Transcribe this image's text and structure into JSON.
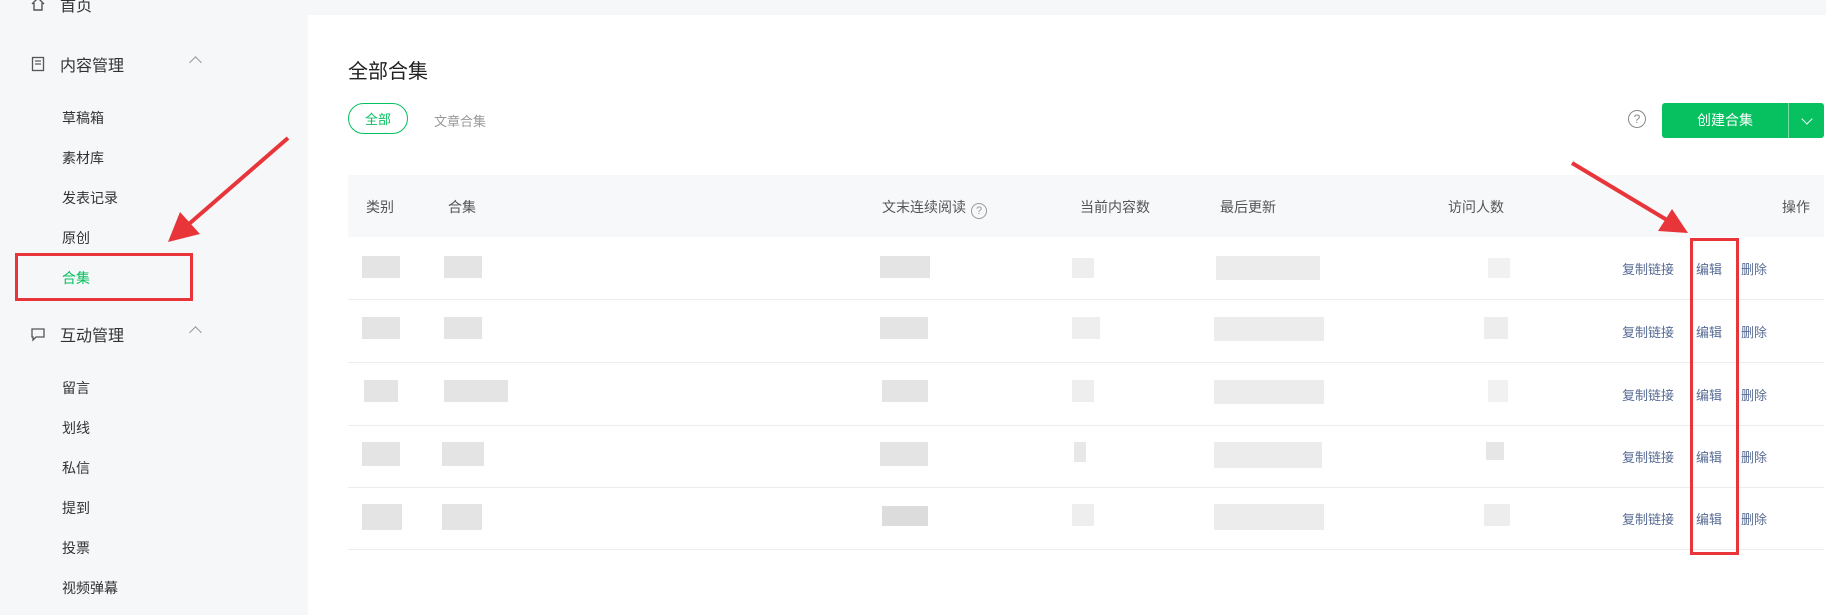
{
  "sidebar": {
    "home_label": "首页",
    "groups": [
      {
        "label": "内容管理",
        "items": [
          "草稿箱",
          "素材库",
          "发表记录",
          "原创",
          "合集"
        ]
      },
      {
        "label": "互动管理",
        "items": [
          "留言",
          "划线",
          "私信",
          "提到",
          "投票",
          "视频弹幕"
        ]
      }
    ],
    "active_item": "合集"
  },
  "main": {
    "title": "全部合集",
    "tabs": [
      "全部",
      "文章合集"
    ],
    "help_icon": "?",
    "create_button_label": "创建合集",
    "table": {
      "headers": [
        "类别",
        "合集",
        "文末连续阅读",
        "当前内容数",
        "最后更新",
        "访问人数",
        "操作"
      ],
      "header_help_icon": "?",
      "row_count": 5,
      "actions": [
        "复制链接",
        "编辑",
        "删除"
      ]
    }
  },
  "colors": {
    "accent": "#07c160",
    "link": "#576b95",
    "annotation": "#e8353a"
  }
}
